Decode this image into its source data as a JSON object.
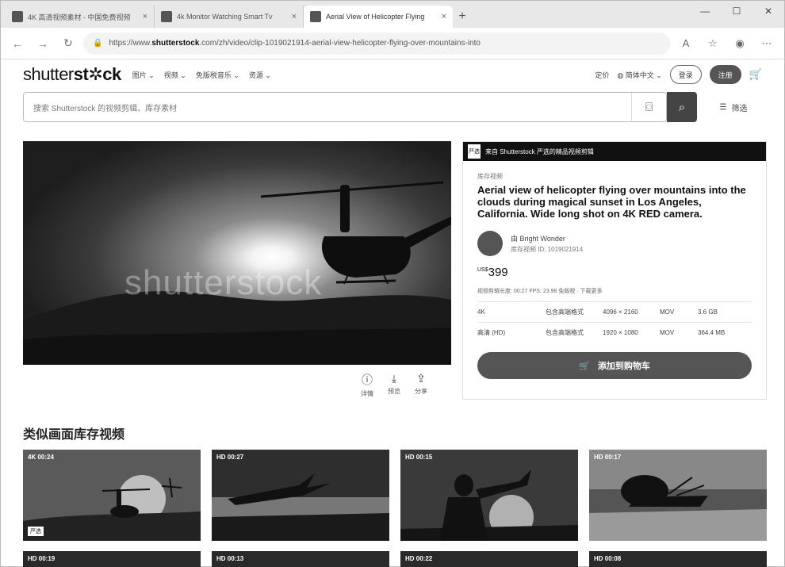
{
  "browser": {
    "tabs": [
      {
        "title": "4K 高清视频素材 - 中国免费视频"
      },
      {
        "title": "4k Monitor Watching Smart Tv"
      },
      {
        "title": "Aerial View of Helicopter Flying"
      }
    ],
    "url_prefix": "https://www.",
    "url_domain": "shutterstock",
    "url_rest": ".com/zh/video/clip-1019021914-aerial-view-helicopter-flying-over-mountains-into"
  },
  "site": {
    "logo_a": "shutter",
    "logo_b": "st",
    "logo_c": "ck",
    "menu": [
      "图片 ⌄",
      "视频 ⌄",
      "免版税音乐 ⌄",
      "资源 ⌄"
    ],
    "pricing": "定价",
    "language": "简体中文 ⌄",
    "login": "登录",
    "signup": "注册",
    "search_placeholder": "搜索 Shutterstock 的视频剪辑、库存素材",
    "filter_label": "筛选"
  },
  "player": {
    "watermark": "shutterstock",
    "actions": [
      {
        "icon": "ⓘ",
        "label": "详情"
      },
      {
        "icon": "⤓",
        "label": "预览"
      },
      {
        "icon": "⇪",
        "label": "分享"
      }
    ]
  },
  "panel": {
    "banner": "来自 Shutterstock 严选的精品视频剪辑",
    "banner_badge": "严选",
    "category": "库存视频",
    "title": "Aerial view of helicopter flying over mountains into the clouds during magical sunset in Los Angeles, California. Wide long shot on 4K RED camera.",
    "author_name": "由 Bright Wonder",
    "author_id": "库存视频 ID: 1019021914",
    "price_currency": "US$",
    "price_value": "399",
    "meta": "视频剪辑长度: 00:27  FPS: 23.98  免版税 · 下载更多",
    "rows": [
      [
        "4K",
        "包含高端格式",
        "4096 × 2160",
        "MOV",
        "3.6 GB"
      ],
      [
        "高清 (HD)",
        "包含高端格式",
        "1920 × 1080",
        "MOV",
        "364.4 MB"
      ]
    ],
    "cart_label": "添加到购物车"
  },
  "similar": {
    "title": "类似画面库存视频",
    "items": [
      {
        "label": "4K 00:24",
        "tag": "严选"
      },
      {
        "label": "HD 00:27"
      },
      {
        "label": "HD 00:15"
      },
      {
        "label": "HD 00:17"
      }
    ],
    "row2": [
      "HD 00:19",
      "HD 00:13",
      "HD 00:22",
      "HD 00:08"
    ]
  }
}
